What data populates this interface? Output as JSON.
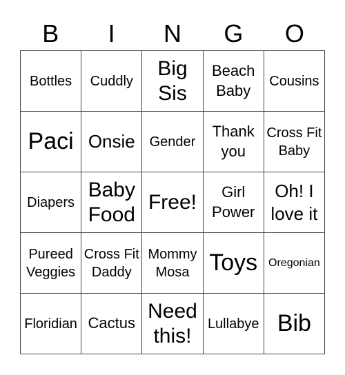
{
  "header": {
    "letters": [
      "B",
      "I",
      "N",
      "G",
      "O"
    ]
  },
  "cells": [
    [
      "Bottles",
      "Cuddly",
      "Big Sis",
      "Beach Baby",
      "Cousins"
    ],
    [
      "Paci",
      "Onsie",
      "Gender",
      "Thank you",
      "Cross Fit Baby"
    ],
    [
      "Diapers",
      "Baby Food",
      "Free!",
      "Girl Power",
      "Oh! I love it"
    ],
    [
      "Pureed Veggies",
      "Cross Fit Daddy",
      "Mommy Mosa",
      "Toys",
      "Oregonian"
    ],
    [
      "Floridian",
      "Cactus",
      "Need this!",
      "Lullabye",
      "Bib"
    ]
  ]
}
